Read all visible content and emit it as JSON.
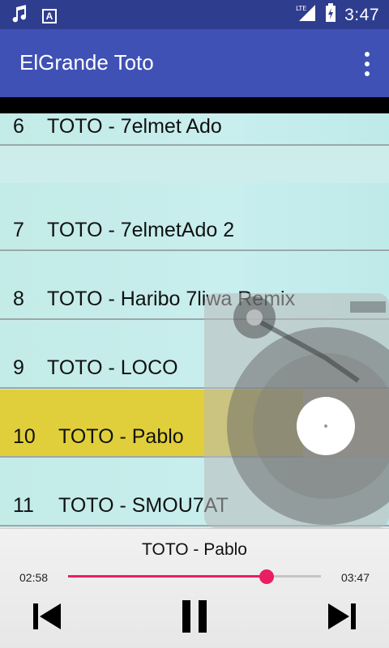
{
  "status_bar": {
    "time": "3:47",
    "network": "LTE"
  },
  "app_bar": {
    "title": "ElGrande Toto"
  },
  "songs": [
    {
      "num": "6",
      "title": "TOTO - 7elmet Ado"
    },
    {
      "num": "7",
      "title": "TOTO - 7elmetAdo 2"
    },
    {
      "num": "8",
      "title": "TOTO - Haribo  7liwa Remix"
    },
    {
      "num": "9",
      "title": "TOTO - LOCO"
    },
    {
      "num": "10",
      "title": "TOTO - Pablo"
    },
    {
      "num": "11",
      "title": "TOTO - SMOU7AT"
    }
  ],
  "player": {
    "title": "TOTO - Pablo",
    "current_time": "02:58",
    "total_time": "03:47",
    "progress": 0.785,
    "accent_color": "#e91e63"
  },
  "colors": {
    "status_bar": "#2f3d8f",
    "app_bar": "#3f51b5",
    "active_row": "#e0cf3a",
    "list_bg": "#c6eceb"
  }
}
